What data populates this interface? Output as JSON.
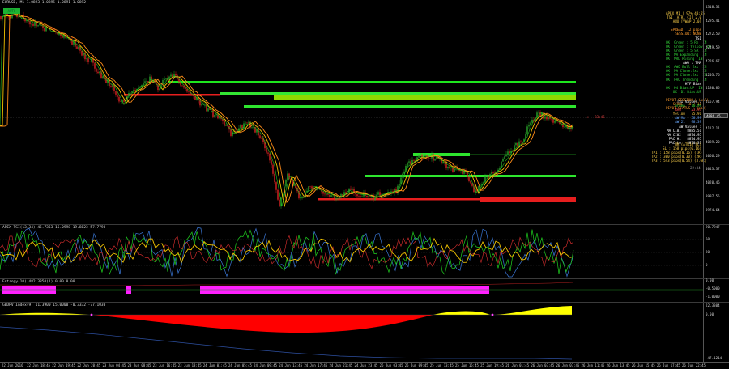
{
  "main": {
    "title": "EURUSD, M1  1.0893  1.0895  1.0891  1.0892",
    "badge": "AUTO",
    "price_level_label": "<-- 83:46"
  },
  "panels": {
    "stats_right": [
      {
        "t": "APEX M1 | 97% 48:55",
        "c": "#ffd24a"
      },
      {
        "t": "TSI [ATR1 CI] 2.0",
        "c": "#ffd24a"
      },
      {
        "t": "AWO [VWAP 2.0]",
        "c": "#ffd24a"
      },
      {
        "t": "",
        "c": "#000"
      },
      {
        "t": "SPREAD: 12 pips",
        "c": "#ff9d2e"
      },
      {
        "t": "SESSION: NONE",
        "c": "#ff9d2e"
      },
      {
        "t": "TSI",
        "c": "#ffffff"
      },
      {
        "t": "OK  Green : 5 Rn  IN",
        "c": "#32d238"
      },
      {
        "t": "OK  Green : Yellow  IN",
        "c": "#32d238"
      },
      {
        "t": "OK  Green : 5 SR  IN",
        "c": "#32d238"
      },
      {
        "t": "OK  MA Expanding  IN",
        "c": "#32d238"
      },
      {
        "t": "OK  MRL Rising  IN",
        "c": "#32d238"
      },
      {
        "t": "AWO : TMA",
        "c": "#ffffff"
      },
      {
        "t": "OK  AWO Bull Ext  IN",
        "c": "#32d238"
      },
      {
        "t": "OK  MA Close:Ext  IN",
        "c": "#32d238"
      },
      {
        "t": "OK  MA Close:Ext  IN",
        "c": "#32d238"
      },
      {
        "t": "OK  PAC Trending  IN",
        "c": "#32d238"
      },
      {
        "t": "HTF Bias",
        "c": "#ffffff"
      },
      {
        "t": "OK  H4 Bias:UP  IN",
        "c": "#32d238"
      },
      {
        "t": "OK  D1 Bias:UP",
        "c": "#32d238"
      },
      {
        "t": "",
        "c": "#000"
      },
      {
        "t": "PIVOT SESSION | (val)",
        "c": "#ff9d2e"
      },
      {
        "t": "SCORE: 10 / 11",
        "c": "#ff9d2e"
      },
      {
        "t": "PIVOT STATUS : (pb3)",
        "c": "#ff9d2e"
      }
    ],
    "values_box": [
      {
        "t": "TSI Values :",
        "c": "#ffffff"
      },
      {
        "t": "Green : 10.99",
        "c": "#32d238"
      },
      {
        "t": "Red   : 23.93",
        "c": "#ff5252"
      },
      {
        "t": "Yellow : 75.91",
        "c": "#ffd24a"
      },
      {
        "t": "AW MA : 58.99",
        "c": "#6aa9ff"
      },
      {
        "t": "AW 21 : 98.39",
        "c": "#6aa9ff"
      },
      {
        "t": "AW Values :",
        "c": "#ffffff"
      },
      {
        "t": "MA CI01 : 8885.51",
        "c": "#ffffff"
      },
      {
        "t": "MA CI02 : 8874.95",
        "c": "#ffffff"
      },
      {
        "t": "PAC Hi : 8874.95",
        "c": "#ffffff"
      },
      {
        "t": "PAC Lo : 8870.31",
        "c": "#ffffff"
      }
    ],
    "mr_box": [
      {
        "t": "MR (ATR14 SL)",
        "c": "#ffd24a"
      },
      {
        "t": "SL : 158 pips(0.16)",
        "c": "#ffd24a"
      },
      {
        "t": "TP1 : 158 pips(0.16) (1R)",
        "c": "#ffd24a"
      },
      {
        "t": "TP2 : 300 pips(0.30) (2R)",
        "c": "#ffd24a"
      },
      {
        "t": "TP3 : 543 pips(0.54) (3.6R)",
        "c": "#ffd24a"
      }
    ],
    "time_small": "22:34"
  },
  "price_axis": [
    "4318.32",
    "4295.41",
    "4272.50",
    "4249.59",
    "4226.67",
    "4203.76",
    "4180.85",
    "4157.94",
    "4135.02",
    "4112.11",
    "4089.20",
    "4066.29",
    "4043.37",
    "4020.46",
    "3997.55",
    "3974.64"
  ],
  "price_current": "4086.45",
  "sub1": {
    "title": "APEX TSI(13,34) 45.7363 16.0998 19.8823 57.7793",
    "axis": [
      "90.7947",
      "50",
      "20",
      "0"
    ]
  },
  "sub2": {
    "title": "Entropy(10) 482.3850(1)  0.00  0.00",
    "axis": [
      "0.00",
      "-0.5000",
      "-1.0000"
    ]
  },
  "sub3": {
    "title": "GBDRV Index(9) 11.3900 15.0000 -0.3332 -77.1030",
    "axis": [
      "22.3304",
      "0.00",
      "-47.1214"
    ]
  },
  "time_labels": [
    "22 Jun 2016",
    "22 Jun 18:45",
    "22 Jun 19:45",
    "22 Jun 20:45",
    "23 Jun 04:45",
    "23 Jun 08:45",
    "23 Jun 16:45",
    "23 Jun 18:45",
    "24 Jun 01:45",
    "24 Jun 05:45",
    "24 Jun 09:45",
    "24 Jun 13:45",
    "24 Jun 17:45",
    "24 Jun 21:45",
    "24 Jun 23:45",
    "25 Jun 03:45",
    "25 Jun 09:45",
    "25 Jun 13:45",
    "25 Jun 15:45",
    "25 Jun 19:45",
    "26 Jun 01:45",
    "26 Jun 03:45",
    "26 Jun 07:45",
    "26 Jun 11:45",
    "26 Jun 13:45",
    "26 Jun 15:45",
    "26 Jun 17:45",
    "26 Jun 22:45"
  ]
}
